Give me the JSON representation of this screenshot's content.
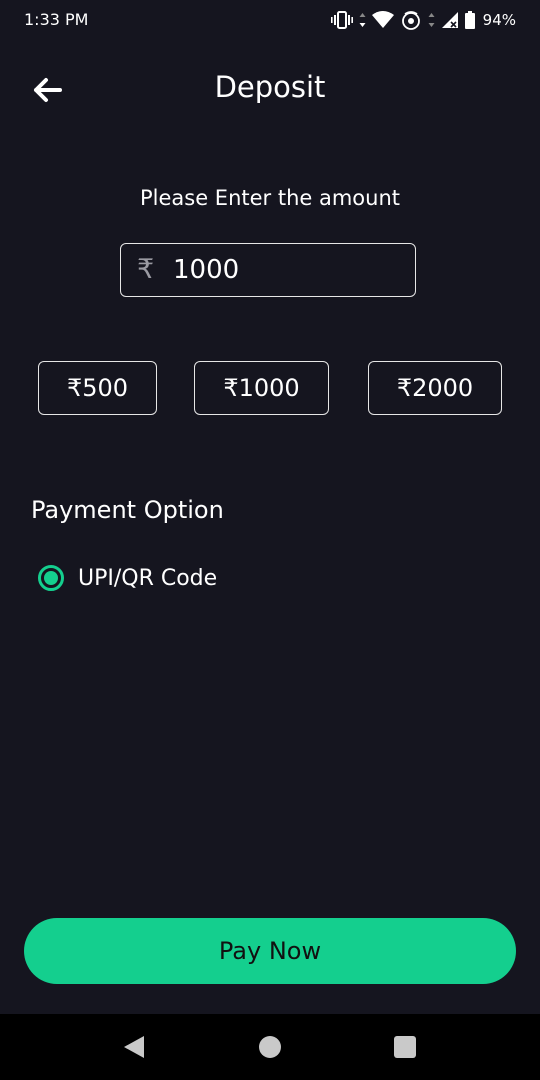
{
  "status_bar": {
    "time": "1:33 PM",
    "battery_percent": "94%",
    "icons": [
      "vibrate-icon",
      "data-arrows-icon",
      "wifi-icon",
      "hotspot-icon",
      "data-arrows-icon",
      "signal-icon",
      "battery-icon"
    ]
  },
  "header": {
    "back_icon": "arrow-left-icon",
    "title": "Deposit"
  },
  "amount": {
    "prompt": "Please Enter the amount",
    "currency_symbol": "₹",
    "value": "1000"
  },
  "presets": [
    {
      "label": "₹500"
    },
    {
      "label": "₹1000"
    },
    {
      "label": "₹2000"
    }
  ],
  "payment": {
    "heading": "Payment Option",
    "options": [
      {
        "label": "UPI/QR Code",
        "selected": true
      }
    ]
  },
  "actions": {
    "pay_label": "Pay Now"
  },
  "nav_bar": {
    "icons": [
      "back-triangle-icon",
      "home-circle-icon",
      "recents-square-icon"
    ]
  },
  "colors": {
    "background": "#15151f",
    "accent": "#14cf8e",
    "border": "#e6e6e6"
  }
}
